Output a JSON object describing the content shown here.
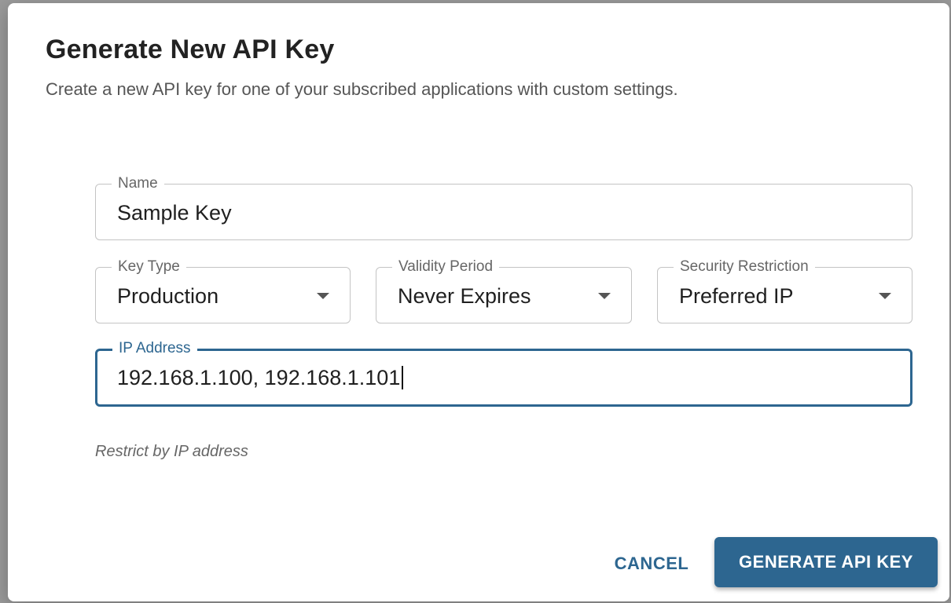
{
  "dialog": {
    "title": "Generate New API Key",
    "subtitle": "Create a new API key for one of your subscribed applications with custom settings."
  },
  "form": {
    "name": {
      "label": "Name",
      "value": "Sample Key"
    },
    "key_type": {
      "label": "Key Type",
      "value": "Production"
    },
    "validity_period": {
      "label": "Validity Period",
      "value": "Never Expires"
    },
    "security_restriction": {
      "label": "Security Restriction",
      "value": "Preferred IP"
    },
    "ip_address": {
      "label": "IP Address",
      "value": "192.168.1.100, 192.168.1.101"
    },
    "helper_text": "Restrict by IP address"
  },
  "actions": {
    "cancel_label": "CANCEL",
    "generate_label": "GENERATE API KEY"
  },
  "colors": {
    "accent": "#2d6690",
    "border": "#c4c4c4"
  },
  "icons": {
    "dropdown": "caret-down-icon"
  }
}
